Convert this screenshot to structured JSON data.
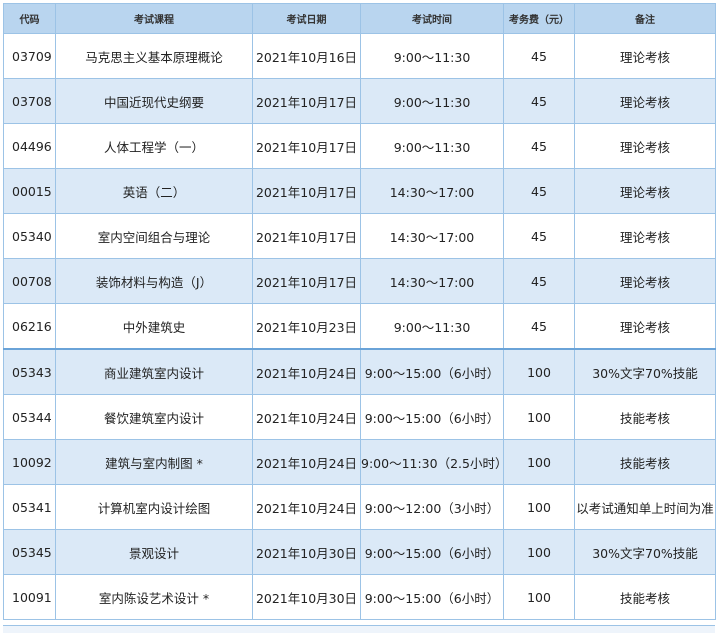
{
  "headers": {
    "code": "代码",
    "course": "考试课程",
    "date": "考试日期",
    "time": "考试时间",
    "fee": "考务费（元）",
    "note": "备注"
  },
  "rows": [
    {
      "code": "03709",
      "course": "马克思主义基本原理概论",
      "date": "2021年10月16日",
      "time": "9:00～11:30",
      "fee": "45",
      "note": "理论考核"
    },
    {
      "code": "03708",
      "course": "中国近现代史纲要",
      "date": "2021年10月17日",
      "time": "9:00～11:30",
      "fee": "45",
      "note": "理论考核"
    },
    {
      "code": "04496",
      "course": "人体工程学（一）",
      "date": "2021年10月17日",
      "time": "9:00～11:30",
      "fee": "45",
      "note": "理论考核"
    },
    {
      "code": "00015",
      "course": "英语（二）",
      "date": "2021年10月17日",
      "time": "14:30～17:00",
      "fee": "45",
      "note": "理论考核"
    },
    {
      "code": "05340",
      "course": "室内空间组合与理论",
      "date": "2021年10月17日",
      "time": "14:30～17:00",
      "fee": "45",
      "note": "理论考核"
    },
    {
      "code": "00708",
      "course": "装饰材料与构造（J）",
      "date": "2021年10月17日",
      "time": "14:30～17:00",
      "fee": "45",
      "note": "理论考核"
    },
    {
      "code": "06216",
      "course": "中外建筑史",
      "date": "2021年10月23日",
      "time": "9:00～11:30",
      "fee": "45",
      "note": "理论考核"
    },
    {
      "code": "05343",
      "course": "商业建筑室内设计",
      "date": "2021年10月24日",
      "time": "9:00～15:00（6小时）",
      "fee": "100",
      "note": "30%文字70%技能"
    },
    {
      "code": "05344",
      "course": "餐饮建筑室内设计",
      "date": "2021年10月24日",
      "time": "9:00～15:00（6小时）",
      "fee": "100",
      "note": "技能考核"
    },
    {
      "code": "10092",
      "course": "建筑与室内制图 *",
      "date": "2021年10月24日",
      "time": "9:00～11:30（2.5小时）",
      "fee": "100",
      "note": "技能考核"
    },
    {
      "code": "05341",
      "course": "计算机室内设计绘图",
      "date": "2021年10月24日",
      "time": "9:00～12:00（3小时）",
      "fee": "100",
      "note": "以考试通知单上时间为准"
    },
    {
      "code": "05345",
      "course": "景观设计",
      "date": "2021年10月30日",
      "time": "9:00～15:00（6小时）",
      "fee": "100",
      "note": "30%文字70%技能"
    },
    {
      "code": "10091",
      "course": "室内陈设艺术设计 *",
      "date": "2021年10月30日",
      "time": "9:00～15:00（6小时）",
      "fee": "100",
      "note": "技能考核"
    }
  ]
}
